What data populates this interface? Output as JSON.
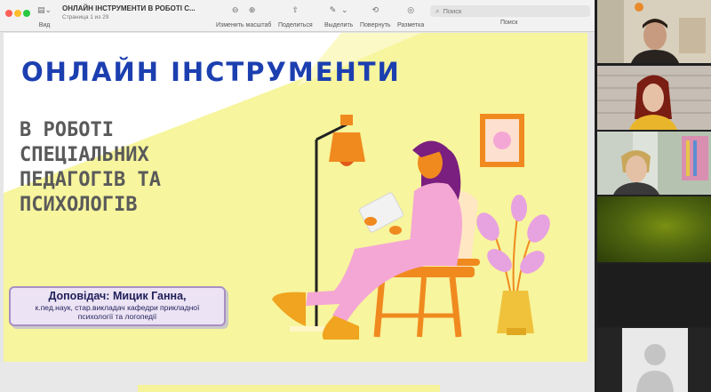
{
  "viewer": {
    "title": "ОНЛАЙН ІНСТРУМЕНТИ В РОБОТІ С...",
    "page_info": "Страница 1 из 29",
    "toolbar": {
      "view_label": "Вид",
      "zoom_label": "Изменить масштаб",
      "share_label": "Поделиться",
      "highlight_label": "Выделить",
      "rotate_label": "Повернуть",
      "markup_label": "Разметка",
      "search_placeholder": "Поиск",
      "search_caption": "Поиск"
    }
  },
  "slide": {
    "title": "ОНЛАЙН ІНСТРУМЕНТИ",
    "subtitle_lines": [
      "В РОБОТІ",
      "СПЕЦІАЛЬНИХ",
      "ПЕДАГОГІВ ТА",
      "ПСИХОЛОГІВ"
    ],
    "speaker": {
      "name": "Доповідач: Мицик Ганна,",
      "desc_line1": "к.пед.наук, стар.викладач кафедри прикладної",
      "desc_line2": "психології та логопедії"
    },
    "colors": {
      "background_shape": "#f7f59d",
      "title": "#1c3fb0",
      "subtitle": "#5a5a5a",
      "accent_orange": "#f08a1f",
      "figure_pink": "#f4a7d4",
      "hair": "#7a1f7f"
    }
  },
  "participants": [
    {
      "id": "participant-1"
    },
    {
      "id": "participant-2"
    },
    {
      "id": "participant-3"
    },
    {
      "id": "participant-4"
    },
    {
      "id": "participant-5"
    },
    {
      "id": "participant-6",
      "avatar": "default-avatar-icon"
    }
  ]
}
